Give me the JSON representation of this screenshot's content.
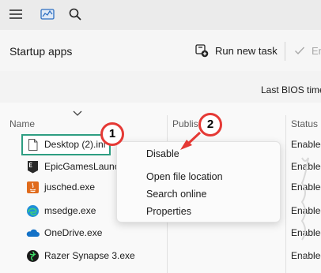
{
  "toolbar": {
    "menu_icon": "hamburger-icon",
    "perf_icon": "performance-chart-icon",
    "search_icon": "search-icon"
  },
  "page": {
    "title": "Startup apps",
    "run_new_task": "Run new task",
    "enable_partial": "En",
    "last_bios": "Last BIOS time"
  },
  "columns": {
    "name": "Name",
    "publisher": "Publis",
    "status": "Status"
  },
  "rows": [
    {
      "name": "Desktop (2).ini",
      "status": "Enabled",
      "icon": "file-icon"
    },
    {
      "name": "EpicGamesLaunch",
      "status": "Enabled",
      "icon": "epic-games-icon"
    },
    {
      "name": "jusched.exe",
      "status": "Enabled",
      "icon": "java-icon"
    },
    {
      "name": "msedge.exe",
      "status": "Enabled",
      "icon": "edge-icon"
    },
    {
      "name": "OneDrive.exe",
      "status": "Enabled",
      "icon": "onedrive-icon"
    },
    {
      "name": "Razer Synapse 3.exe",
      "status": "Enabled",
      "icon": "razer-icon"
    }
  ],
  "context_menu": {
    "items": [
      "Disable",
      "Open file location",
      "Search online",
      "Properties"
    ]
  },
  "callouts": [
    "1",
    "2"
  ],
  "colors": {
    "highlight": "#2e9e82",
    "callout_red": "#e53935"
  }
}
